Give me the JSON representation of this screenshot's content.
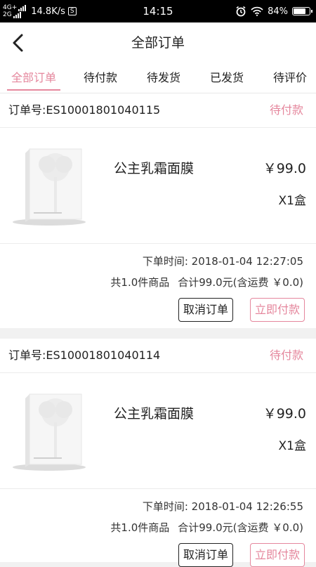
{
  "status_bar": {
    "net_top": "4G+",
    "net_bottom": "2G",
    "speed": "14.8K/s",
    "sim": "S",
    "time": "14:15",
    "battery": "84%",
    "battery_level": 84
  },
  "header": {
    "title": "全部订单",
    "back_icon": "chevron-left-icon"
  },
  "tabs": [
    {
      "label": "全部订单",
      "active": true
    },
    {
      "label": "待付款",
      "active": false
    },
    {
      "label": "待发货",
      "active": false
    },
    {
      "label": "已发货",
      "active": false
    },
    {
      "label": "待评价",
      "active": false
    }
  ],
  "orders": [
    {
      "order_no": "订单号:ES10001801040115",
      "status": "待付款",
      "product_name": "公主乳霜面膜",
      "price": "￥99.0",
      "qty": "X1盒",
      "order_time": "下单时间: 2018-01-04 12:27:05",
      "item_count": "共1.0件商品",
      "total": "合计99.0元(含运费 ￥0.0)",
      "cancel_label": "取消订单",
      "pay_label": "立即付款"
    },
    {
      "order_no": "订单号:ES10001801040114",
      "status": "待付款",
      "product_name": "公主乳霜面膜",
      "price": "￥99.0",
      "qty": "X1盒",
      "order_time": "下单时间: 2018-01-04 12:26:55",
      "item_count": "共1.0件商品",
      "total": "合计99.0元(含运费 ￥0.0)",
      "cancel_label": "取消订单",
      "pay_label": "立即付款"
    }
  ],
  "colors": {
    "accent": "#e5879d",
    "background": "#f1f1f1"
  }
}
